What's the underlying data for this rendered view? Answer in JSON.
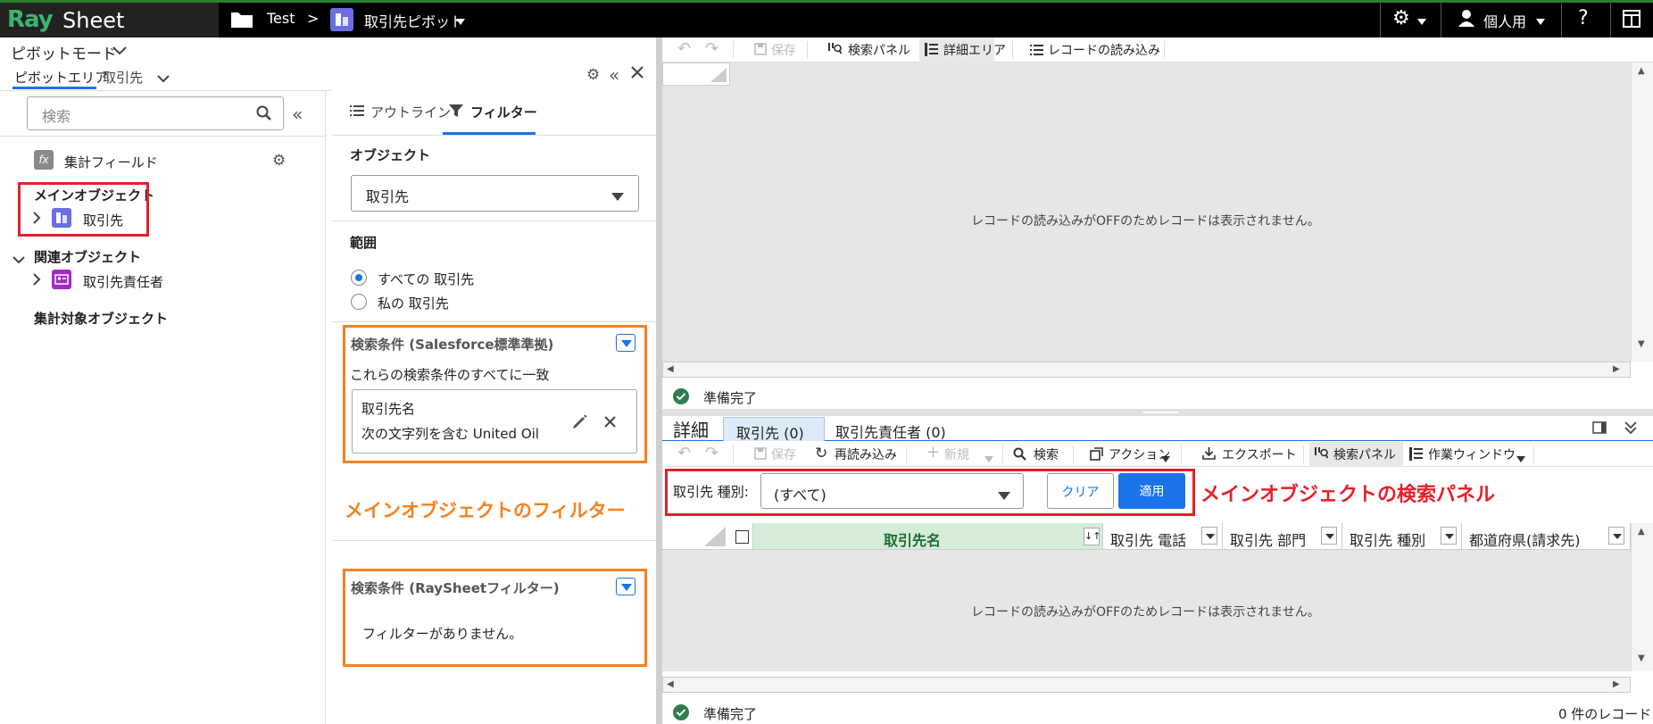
{
  "app": {
    "logo_ray": "Ray",
    "logo_sheet": "Sheet",
    "breadcrumb_test": "Test",
    "breadcrumb_sep": ">",
    "breadcrumb_current": "取引先ピボット",
    "user_label": "個人用",
    "help_label": "?"
  },
  "left": {
    "mode_label": "ピボットモード",
    "tab_pivot": "ピボットエリア",
    "tab_account": "取引先",
    "search_placeholder": "検索",
    "calc_field": "集計フィールド",
    "main_object_heading": "メインオブジェクト",
    "main_object_item": "取引先",
    "related_heading": "関連オブジェクト",
    "related_item": "取引先責任者",
    "aggregate_heading": "集計対象オブジェクト"
  },
  "filter": {
    "tab_outline": "アウトライン",
    "tab_filter": "フィルター",
    "object_label": "オブジェクト",
    "object_value": "取引先",
    "scope_label": "範囲",
    "scope_options": [
      "すべての 取引先",
      "私の 取引先"
    ],
    "sf_heading": "検索条件 (Salesforce標準準拠)",
    "sf_match": "これらの検索条件のすべてに一致",
    "cond_field": "取引先名",
    "cond_value": "次の文字列を含む United Oil",
    "annotation_filter": "メインオブジェクトのフィルター",
    "rs_heading": "検索条件 (RaySheetフィルター)",
    "rs_empty": "フィルターがありません。"
  },
  "main": {
    "toolbar": {
      "undo": "↶",
      "redo": "↷",
      "save": "保存",
      "search_panel": "検索パネル",
      "detail_area": "詳細エリア",
      "load_records": "レコードの読み込み"
    },
    "empty_message": "レコードの読み込みがOFFのためレコードは表示されません。",
    "status_ready": "準備完了"
  },
  "detail": {
    "title": "詳細",
    "tabs": [
      "取引先 (0)",
      "取引先責任者 (0)"
    ],
    "toolbar": {
      "save": "保存",
      "reload": "再読み込み",
      "new": "新規",
      "search": "検索",
      "action": "アクション",
      "export": "エクスポート",
      "search_panel": "検索パネル",
      "work_window": "作業ウィンドウ"
    },
    "search_panel": {
      "label": "取引先 種別:",
      "value": "(すべて)",
      "clear": "クリア",
      "apply": "適用"
    },
    "annotation_search": "メインオブジェクトの検索パネル",
    "columns": [
      "取引先名",
      "取引先 電話",
      "取引先 部門",
      "取引先 種別",
      "都道府県(請求先)"
    ],
    "empty_message": "レコードの読み込みがOFFのためレコードは表示されません。",
    "status_ready": "準備完了",
    "record_count": "0 件のレコード"
  },
  "colors": {
    "accent_blue": "#1a73e8",
    "annotation_orange": "#f5821f",
    "annotation_red": "#e5202b",
    "logo_green": "#3cb371",
    "header_green": "#d5ecd9"
  }
}
